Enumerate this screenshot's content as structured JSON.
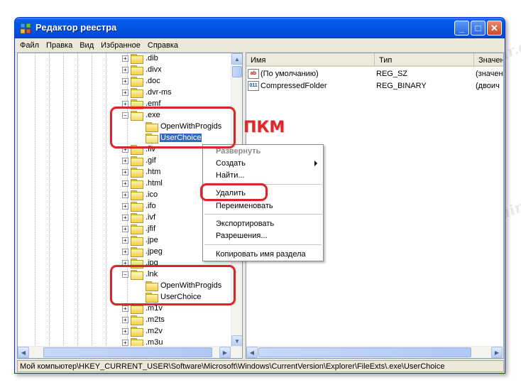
{
  "window": {
    "title": "Редактор реестра",
    "controls": {
      "minimize": "_",
      "maximize": "□",
      "close": "✕"
    }
  },
  "menubar": [
    "Файл",
    "Правка",
    "Вид",
    "Избранное",
    "Справка"
  ],
  "tree": {
    "items": [
      {
        "label": ".dib",
        "expander": "+"
      },
      {
        "label": ".divx",
        "expander": "+"
      },
      {
        "label": ".doc",
        "expander": "+"
      },
      {
        "label": ".dvr-ms",
        "expander": "+"
      },
      {
        "label": ".emf",
        "expander": "+"
      },
      {
        "label": ".exe",
        "expander": "−"
      },
      {
        "label": "OpenWithProgids"
      },
      {
        "label": "UserChoice",
        "selected": true
      },
      {
        "label": ".flv",
        "expander": "+"
      },
      {
        "label": ".gif",
        "expander": "+"
      },
      {
        "label": ".htm",
        "expander": "+"
      },
      {
        "label": ".html",
        "expander": "+"
      },
      {
        "label": ".ico",
        "expander": "+"
      },
      {
        "label": ".ifo",
        "expander": "+"
      },
      {
        "label": ".ivf",
        "expander": "+"
      },
      {
        "label": ".jfif",
        "expander": "+"
      },
      {
        "label": ".jpe",
        "expander": "+"
      },
      {
        "label": ".jpeg",
        "expander": "+"
      },
      {
        "label": ".jpg",
        "expander": "+"
      },
      {
        "label": ".lnk",
        "expander": "−"
      },
      {
        "label": "OpenWithProgids"
      },
      {
        "label": "UserChoice"
      },
      {
        "label": ".m1v",
        "expander": "+"
      },
      {
        "label": ".m2ts",
        "expander": "+"
      },
      {
        "label": ".m2v",
        "expander": "+"
      },
      {
        "label": ".m3u",
        "expander": "+"
      }
    ]
  },
  "list": {
    "columns": [
      "Имя",
      "Тип",
      "Значен"
    ],
    "rows": [
      {
        "icon": "ab",
        "name": "(По умолчанию)",
        "type": "REG_SZ",
        "value": "(значен"
      },
      {
        "icon": "011",
        "name": "CompressedFolder",
        "type": "REG_BINARY",
        "value": "(двоич"
      }
    ]
  },
  "context_menu": {
    "items": [
      "Развернуть",
      "Создать",
      "Найти...",
      "Удалить",
      "Переименовать",
      "Экспортировать",
      "Разрешения...",
      "Копировать имя раздела"
    ]
  },
  "annotation": {
    "label": "ПКМ"
  },
  "statusbar": {
    "path": "Мой компьютер\\HKEY_CURRENT_USER\\Software\\Microsoft\\Windows\\CurrentVersion\\Explorer\\FileExts\\.exe\\UserChoice"
  },
  "watermark": {
    "text": "Soringpcrepair.com"
  },
  "colors": {
    "highlight": "#d9262a",
    "selection": "#316ac5",
    "titlebar": "#0055e3"
  }
}
